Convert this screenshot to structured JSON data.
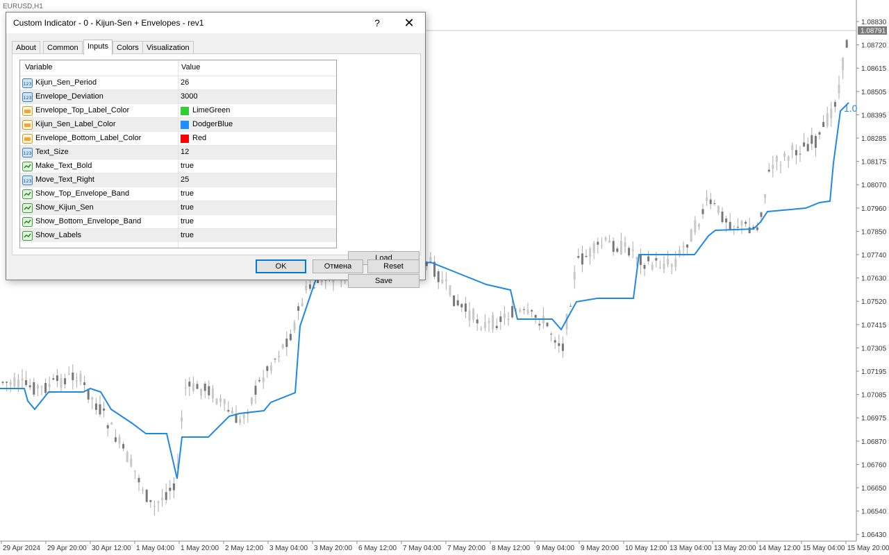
{
  "chart": {
    "symbol_title": "EURUSD,H1",
    "current_price_label": "1.08791",
    "right_edge_label": "1.0",
    "price_ticks": [
      "1.08830",
      "1.08720",
      "1.08615",
      "1.08505",
      "1.08395",
      "1.08285",
      "1.08175",
      "1.08070",
      "1.07960",
      "1.07850",
      "1.07740",
      "1.07630",
      "1.07520",
      "1.07415",
      "1.07305",
      "1.07195",
      "1.07085",
      "1.06975",
      "1.06870",
      "1.06760",
      "1.06650",
      "1.06540",
      "1.06430"
    ],
    "time_ticks": [
      "29 Apr 2024",
      "29 Apr 20:00",
      "30 Apr 12:00",
      "1 May 04:00",
      "1 May 20:00",
      "2 May 12:00",
      "3 May 04:00",
      "3 May 20:00",
      "6 May 12:00",
      "7 May 04:00",
      "7 May 20:00",
      "8 May 12:00",
      "9 May 04:00",
      "9 May 20:00",
      "10 May 12:00",
      "13 May 04:00",
      "13 May 20:00",
      "14 May 12:00",
      "15 May 04:00",
      "15 May 20:00"
    ],
    "kijun_color": "#1e88e5",
    "candle_color": "#777777"
  },
  "dialog": {
    "title": "Custom Indicator - 0 - Kijun-Sen + Envelopes - rev1",
    "help_label": "?",
    "close_label": "✕",
    "tabs": [
      "About",
      "Common",
      "Inputs",
      "Colors",
      "Visualization"
    ],
    "active_tab": "Inputs",
    "columns": {
      "variable": "Variable",
      "value": "Value"
    },
    "rows": [
      {
        "name": "Kijun_Sen_Period",
        "value": "26",
        "type": "int-icon"
      },
      {
        "name": "Envelope_Deviation",
        "value": "3000",
        "type": "int-icon"
      },
      {
        "name": "Envelope_Top_Label_Color",
        "value": "LimeGreen",
        "type": "color-icon",
        "swatch": "#32cd32"
      },
      {
        "name": "Kijun_Sen_Label_Color",
        "value": "DodgerBlue",
        "type": "color-icon",
        "swatch": "#1e90ff"
      },
      {
        "name": "Envelope_Bottom_Label_Color",
        "value": "Red",
        "type": "color-icon",
        "swatch": "#ff0000"
      },
      {
        "name": "Text_Size",
        "value": "12",
        "type": "int-icon"
      },
      {
        "name": "Make_Text_Bold",
        "value": "true",
        "type": "bool-icon"
      },
      {
        "name": "Move_Text_Right",
        "value": "25",
        "type": "int-icon"
      },
      {
        "name": "Show_Top_Envelope_Band",
        "value": "true",
        "type": "bool-icon"
      },
      {
        "name": "Show_Kijun_Sen",
        "value": "true",
        "type": "bool-icon"
      },
      {
        "name": "Show_Bottom_Envelope_Band",
        "value": "true",
        "type": "bool-icon"
      },
      {
        "name": "Show_Labels",
        "value": "true",
        "type": "bool-icon"
      }
    ],
    "buttons": {
      "load": "Load",
      "save": "Save",
      "ok": "OK",
      "cancel": "Отмена",
      "reset": "Reset"
    }
  }
}
